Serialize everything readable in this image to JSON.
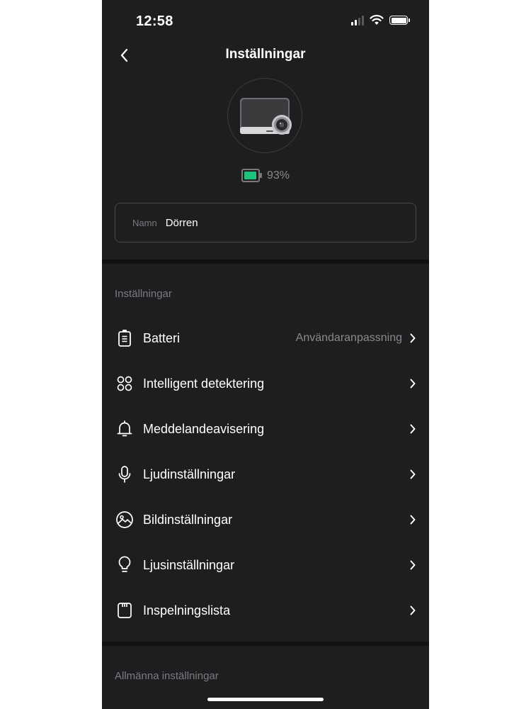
{
  "status_bar": {
    "time": "12:58"
  },
  "header": {
    "title": "Inställningar"
  },
  "device": {
    "battery_percent": "93%",
    "battery_level": 0.93,
    "battery_color": "#1fc37e"
  },
  "name_field": {
    "label": "Namn",
    "value": "Dörren"
  },
  "settings_section": {
    "title": "Inställningar",
    "items": [
      {
        "label": "Batteri",
        "value": "Användaranpassning",
        "icon": "battery-icon"
      },
      {
        "label": "Intelligent detektering",
        "value": "",
        "icon": "grid-circles-icon"
      },
      {
        "label": "Meddelandeavisering",
        "value": "",
        "icon": "bell-icon"
      },
      {
        "label": "Ljudinställningar",
        "value": "",
        "icon": "microphone-icon"
      },
      {
        "label": "Bildinställningar",
        "value": "",
        "icon": "image-icon"
      },
      {
        "label": "Ljusinställningar",
        "value": "",
        "icon": "lightbulb-icon"
      },
      {
        "label": "Inspelningslista",
        "value": "",
        "icon": "sd-card-icon"
      }
    ]
  },
  "general_section": {
    "title": "Allmänna inställningar"
  }
}
